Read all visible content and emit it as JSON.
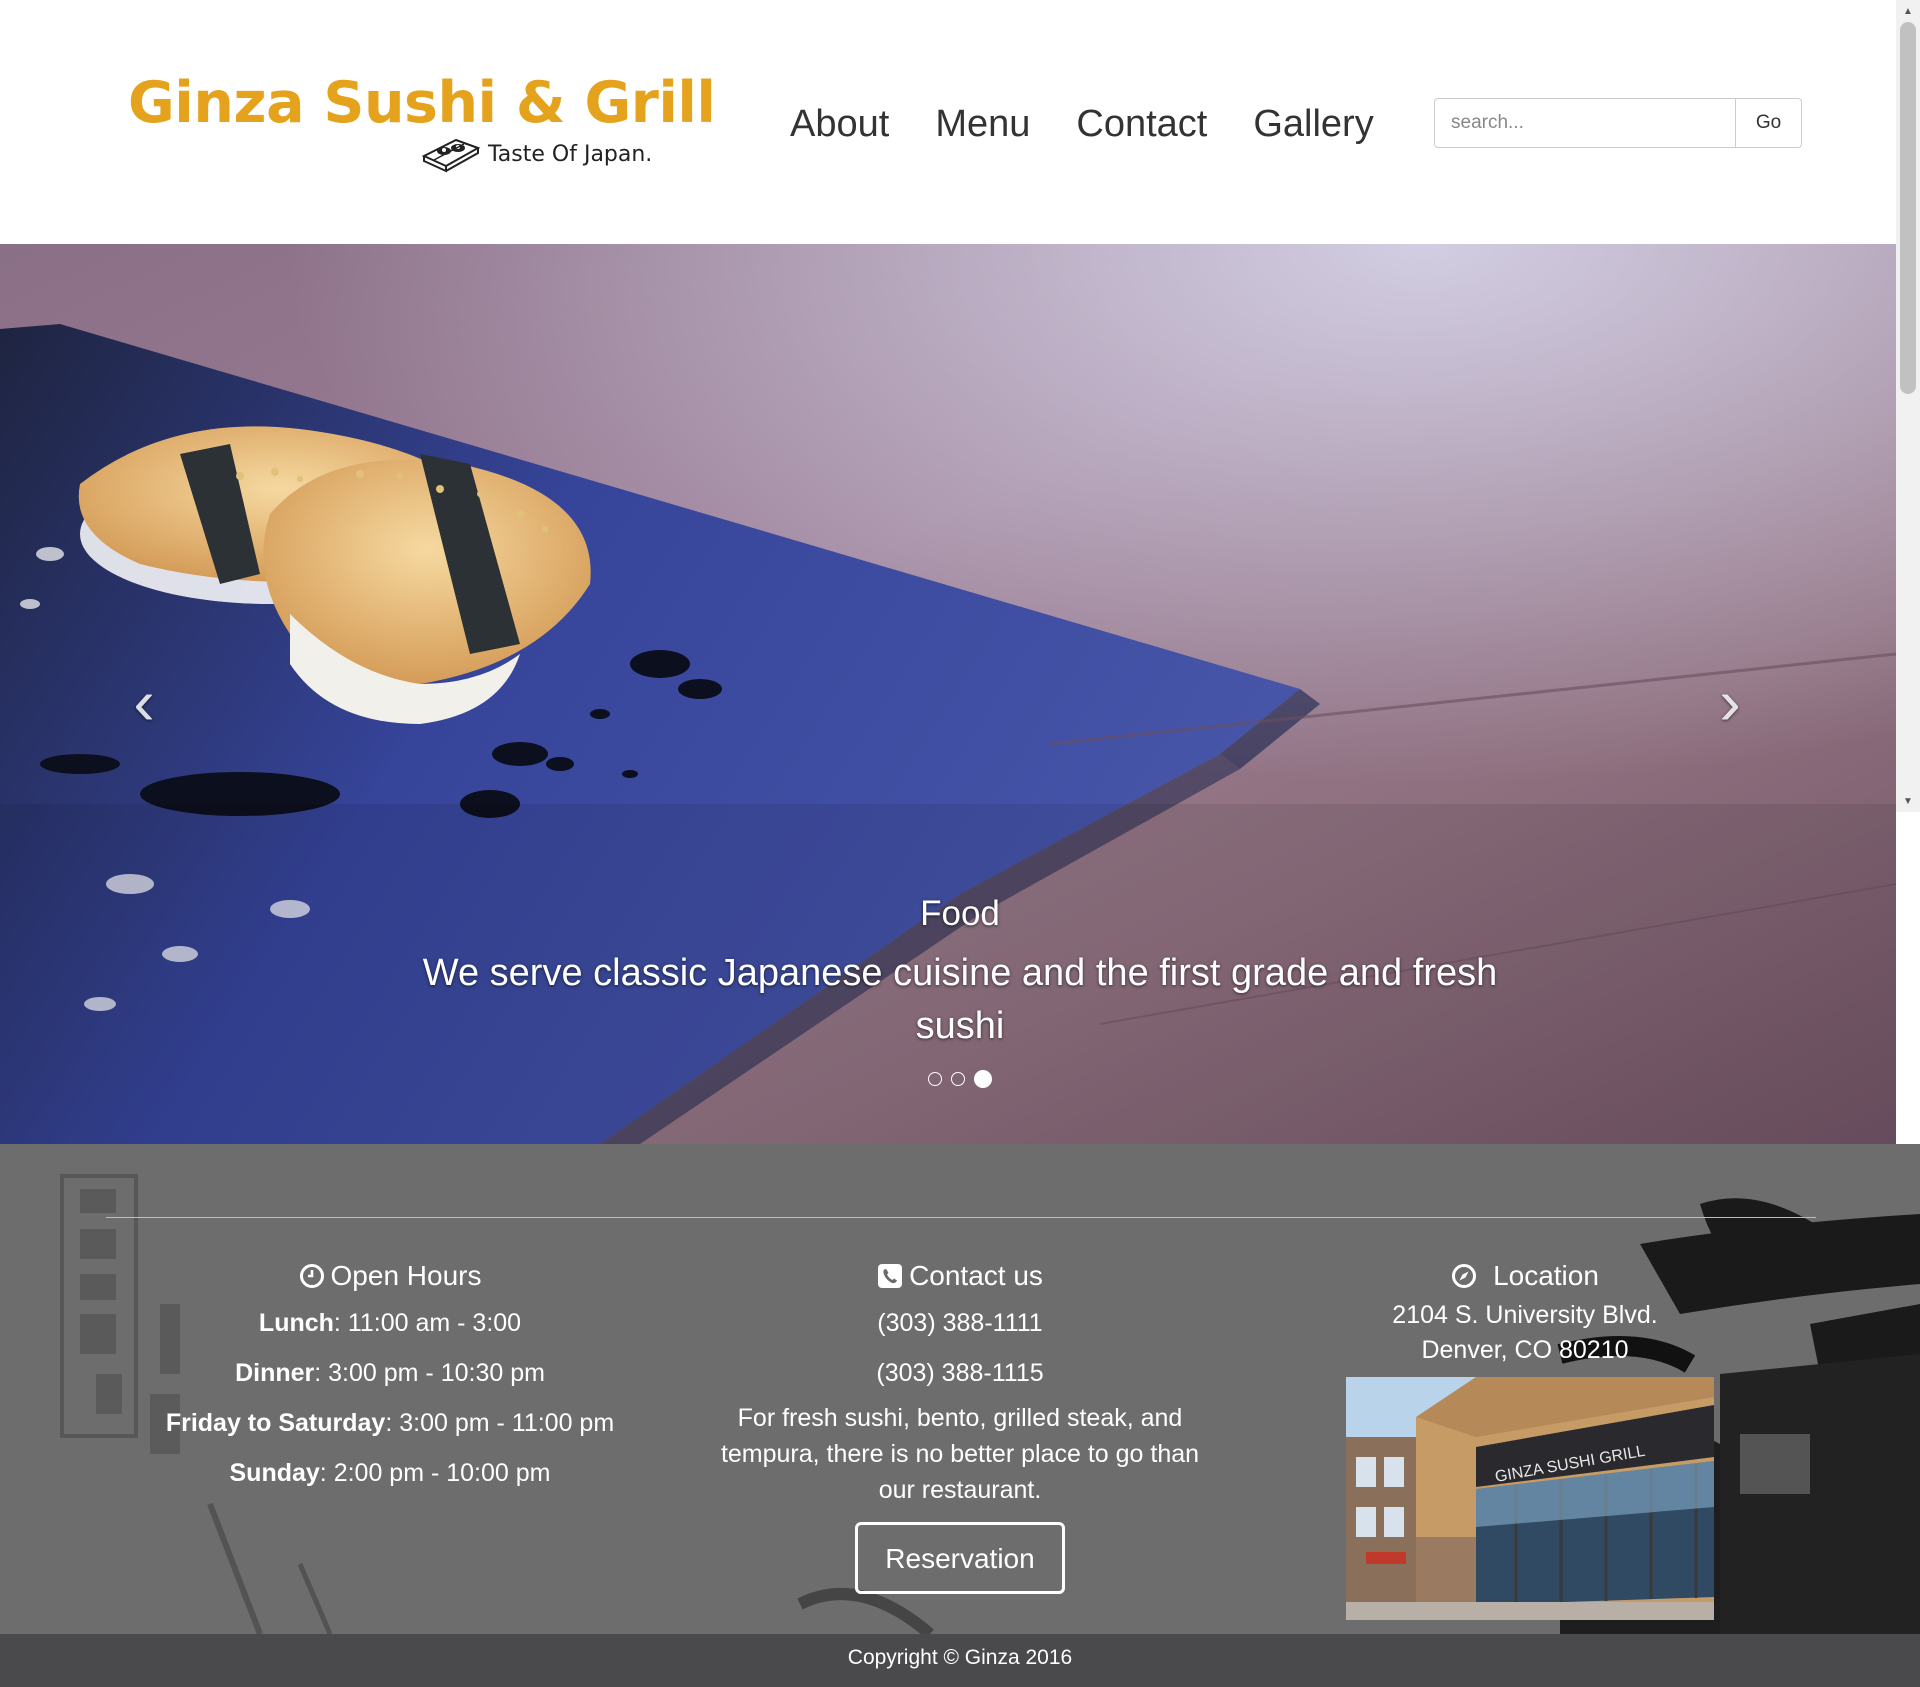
{
  "brand": {
    "name": "Ginza Sushi & Grill",
    "tagline": "Taste Of Japan.",
    "color": "#e5a21c"
  },
  "nav": {
    "items": [
      {
        "label": "About"
      },
      {
        "label": "Menu"
      },
      {
        "label": "Contact"
      },
      {
        "label": "Gallery"
      }
    ]
  },
  "search": {
    "placeholder": "search...",
    "value": "",
    "button_label": "Go"
  },
  "carousel": {
    "slide_title": "Food",
    "slide_text": "We serve classic Japanese cuisine and the first grade and fresh sushi",
    "prev_icon": "chevron-left-icon",
    "next_icon": "chevron-right-icon",
    "slide_count": 3,
    "active_index": 2
  },
  "hours": {
    "title": "Open Hours",
    "icon": "clock-icon",
    "rows": [
      {
        "label": "Lunch",
        "value": ": 11:00 am - 3:00"
      },
      {
        "label": "Dinner",
        "value": ": 3:00 pm - 10:30 pm"
      },
      {
        "label": "Friday to Saturday",
        "value": ": 3:00 pm - 11:00 pm"
      },
      {
        "label": "Sunday",
        "value": ": 2:00 pm - 10:00 pm"
      }
    ]
  },
  "contact": {
    "title": "Contact us",
    "icon": "phone-icon",
    "phones": [
      "(303) 388-1111",
      "(303) 388-1115"
    ],
    "description": "For fresh sushi, bento, grilled steak, and tempura, there is no better place to go than our restaurant.",
    "reservation_label": "Reservation"
  },
  "location": {
    "title": "Location",
    "icon": "compass-icon",
    "address_line1": "2104 S. University Blvd.",
    "address_line2": "Denver, CO 80210"
  },
  "footer": {
    "copyright": "Copyright © Ginza 2016"
  }
}
